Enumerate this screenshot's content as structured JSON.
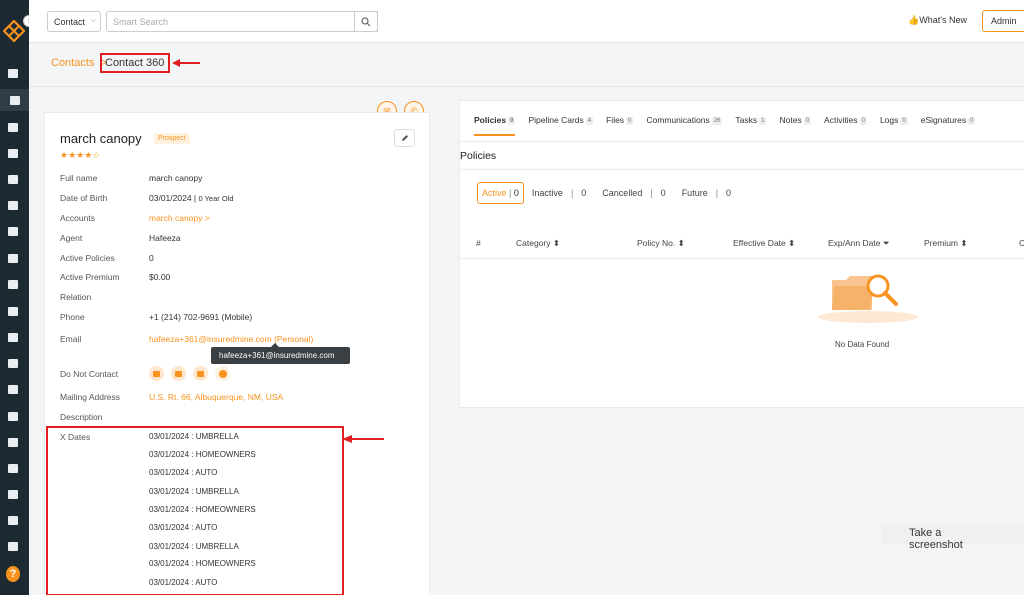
{
  "topbar": {
    "entity_select": "Contact",
    "search_placeholder": "Smart Search",
    "whats_new": "What's New",
    "admin_label": "Admin"
  },
  "breadcrumb": {
    "parent": "Contacts",
    "separator": ">",
    "current": "Contact 360"
  },
  "contact": {
    "name": "march canopy",
    "badge": "Prospect",
    "rating": "★★★★☆",
    "rows": [
      {
        "label": "Full name",
        "value": "march canopy"
      },
      {
        "label": "Date of Birth",
        "value": "03/01/2024 |",
        "value_small": "0 Year Old"
      },
      {
        "label": "Accounts",
        "value": "march canopy >"
      },
      {
        "label": "Agent",
        "value": "Hafeeza"
      },
      {
        "label": "Active Policies",
        "value": "0"
      },
      {
        "label": "Active Premium",
        "value": "$0.00"
      },
      {
        "label": "Relation",
        "value": ""
      },
      {
        "label": "Phone",
        "value": "+1 (214) 702-9691 (Mobile)"
      },
      {
        "label": "Email",
        "value": "hafeeza+361@insuredmine.com  (Personal)"
      },
      {
        "label": "Do Not Contact",
        "value": ""
      },
      {
        "label": "Mailing Address",
        "value": "U.S. Rt. 66, Albuquerque, NM, USA"
      },
      {
        "label": "Description",
        "value": ""
      },
      {
        "label": "X Dates",
        "value": ""
      }
    ],
    "email_tooltip": "hafeeza+361@insuredmine.com",
    "x_dates": [
      "03/01/2024 : UMBRELLA",
      "03/01/2024 : HOMEOWNERS",
      "03/01/2024 : AUTO",
      "03/01/2024 : UMBRELLA",
      "03/01/2024 : HOMEOWNERS",
      "03/01/2024 : AUTO",
      "03/01/2024 : UMBRELLA",
      "03/01/2024 : HOMEOWNERS",
      "03/01/2024 : AUTO"
    ]
  },
  "tabs": [
    {
      "label": "Policies",
      "count": "0"
    },
    {
      "label": "Pipeline Cards",
      "count": "4"
    },
    {
      "label": "Files",
      "count": "0"
    },
    {
      "label": "Communications",
      "count": "26"
    },
    {
      "label": "Tasks",
      "count": "1"
    },
    {
      "label": "Notes",
      "count": "0"
    },
    {
      "label": "Activities",
      "count": "0"
    },
    {
      "label": "Logs",
      "count": "0"
    },
    {
      "label": "eSignatures",
      "count": "0"
    }
  ],
  "policies": {
    "title": "Policies",
    "filters": [
      {
        "label": "Active",
        "count": "0"
      },
      {
        "label": "Inactive",
        "count": "0"
      },
      {
        "label": "Cancelled",
        "count": "0"
      },
      {
        "label": "Future",
        "count": "0"
      }
    ],
    "columns": [
      "#",
      "Category ⬍",
      "Policy No. ⬍",
      "Effective Date ⬍",
      "Exp/Ann Date ⏷",
      "Premium ⬍",
      "C"
    ],
    "empty_text": "No Data Found"
  },
  "screenshot_button": "Take a screenshot",
  "colors": {
    "accent": "#f7931e",
    "sidebar": "#1e2a32",
    "highlight": "#e02020"
  }
}
